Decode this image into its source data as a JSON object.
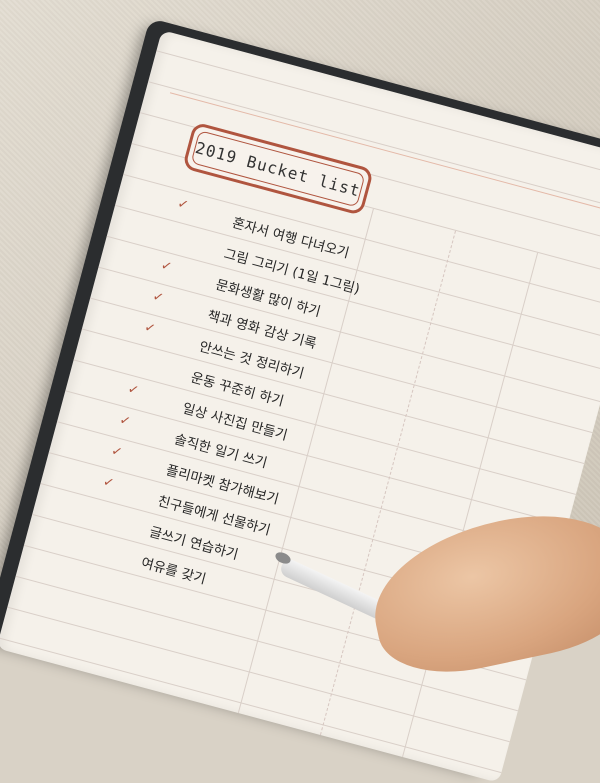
{
  "scene": {
    "colors": {
      "background": "#d9d2c6",
      "cover": "#2b2d2f",
      "page": "#f5f1ea",
      "accent": "#b0553f"
    }
  },
  "bucket_list": {
    "title": "2019 Bucket list",
    "items": [
      {
        "text": "혼자서 여행 다녀오기",
        "checked": true
      },
      {
        "text": "그림 그리기 (1일 1그림)",
        "checked": false
      },
      {
        "text": "문화생활 많이 하기",
        "checked": true
      },
      {
        "text": "책과 영화 감상 기록",
        "checked": true
      },
      {
        "text": "안쓰는 것 정리하기",
        "checked": true
      },
      {
        "text": "운동 꾸준히 하기",
        "checked": false
      },
      {
        "text": "일상 사진집 만들기",
        "checked": true
      },
      {
        "text": "솔직한 일기 쓰기",
        "checked": true
      },
      {
        "text": "플리마켓 참가해보기",
        "checked": true
      },
      {
        "text": "친구들에게 선물하기",
        "checked": true
      },
      {
        "text": "글쓰기 연습하기",
        "checked": false
      },
      {
        "text": "여유를 갖기",
        "checked": false
      }
    ],
    "check_mark": "✓"
  }
}
